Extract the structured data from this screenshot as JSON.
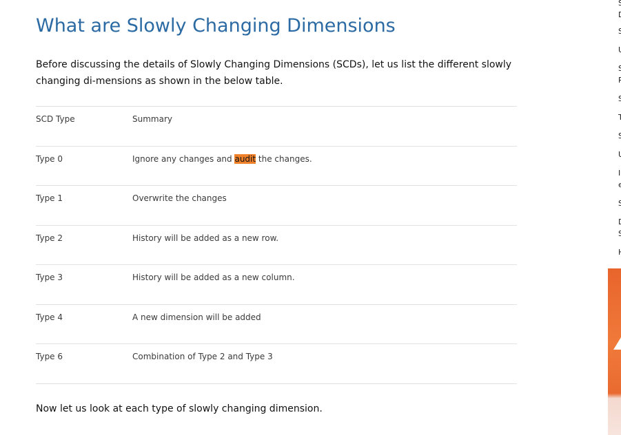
{
  "article": {
    "title": "What are Slowly Changing Dimensions",
    "intro": "Before discussing the details of Slowly Changing Dimensions (SCDs), let us list the different slowly changing di-mensions as shown in the below table.",
    "outro": "Now let us look at each type of slowly changing dimension."
  },
  "scd_table": {
    "headers": [
      "SCD Type",
      "Summary"
    ],
    "rows": [
      {
        "type": "Type 0",
        "summary_before": "Ignore any changes and ",
        "summary_highlight": "audit",
        "summary_after": " the changes."
      },
      {
        "type": "Type 1",
        "summary": "Overwrite the changes"
      },
      {
        "type": "Type 2",
        "summary": "History will be added as a new row."
      },
      {
        "type": "Type 3",
        "summary": "History will be added as a new column."
      },
      {
        "type": "Type 4",
        "summary": "A new dimension will be added"
      },
      {
        "type": "Type 6",
        "summary": "Combination of Type 2 and Type 3"
      }
    ]
  },
  "sidebar": {
    "links": [
      {
        "first_line": "S",
        "second_line": "D"
      },
      {
        "first_line": "S"
      },
      {
        "first_line": "U"
      },
      {
        "first_line": "S",
        "second_line": "P"
      },
      {
        "first_line": "S"
      },
      {
        "first_line": "T"
      },
      {
        "first_line": "S"
      },
      {
        "first_line": "U"
      },
      {
        "first_line": "I",
        "second_line": "e"
      },
      {
        "first_line": "S"
      },
      {
        "first_line": "D",
        "second_line": "S"
      },
      {
        "first_line": "H"
      }
    ]
  },
  "colors": {
    "title": "#2b6aa3",
    "highlight": "#f0812b",
    "ad_background": "#e8642c"
  }
}
